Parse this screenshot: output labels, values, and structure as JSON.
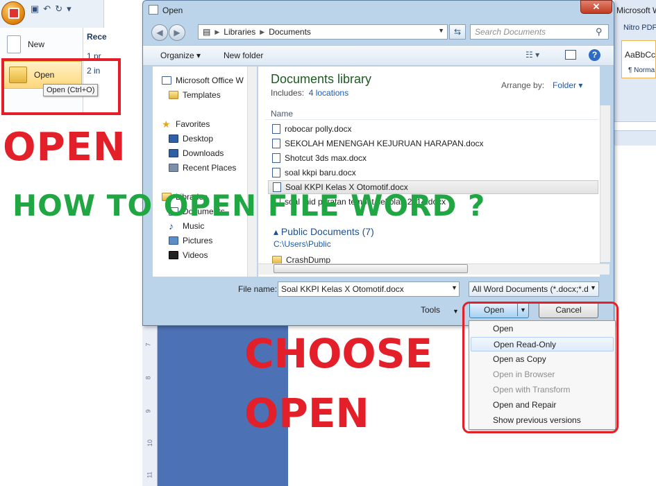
{
  "word": {
    "menu": {
      "new_label": "New",
      "open_label": "Open",
      "open_tooltip": "Open (Ctrl+O)",
      "recent_title": "Rece",
      "recent_items": [
        "1  pr",
        "2  in"
      ]
    },
    "right": {
      "title": "Microsoft W",
      "tab": "Nitro PDF",
      "style_sample": "AaBbCc",
      "style_name": "¶ Norma"
    },
    "ruler_numbers": [
      "7",
      "8",
      "9",
      "10",
      "11"
    ]
  },
  "dialog": {
    "title": "Open",
    "close_glyph": "✕",
    "breadcrumb": [
      "Libraries",
      "Documents"
    ],
    "search_placeholder": "Search Documents",
    "toolbar": {
      "organize": "Organize ▾",
      "new_folder": "New folder",
      "help": "?"
    },
    "nav": {
      "word_root": "Microsoft Office W",
      "templates": "Templates",
      "favorites": "Favorites",
      "desktop": "Desktop",
      "downloads": "Downloads",
      "recent_places": "Recent Places",
      "libraries": "Libraries",
      "documents": "Documents",
      "music": "Music",
      "pictures": "Pictures",
      "videos": "Videos"
    },
    "library": {
      "title": "Documents library",
      "includes_label": "Includes:",
      "includes_link": "4 locations",
      "arrange_label": "Arrange by:",
      "arrange_value": "Folder ▾",
      "column_name": "Name"
    },
    "files": [
      "robocar polly.docx",
      "SEKOLAH MENENGAH KEJURUAN HARAPAN.docx",
      "Shotcut 3ds max.docx",
      "soal kkpi baru.docx",
      "Soal KKPI Kelas X Otomotif.docx",
      "soal mid peratan tempat sekolah 2014.docx"
    ],
    "selected_index": 4,
    "public_group": {
      "title": "Public Documents (7)",
      "path": "C:\\Users\\Public",
      "first_item": "CrashDump"
    },
    "file_name_label": "File name:",
    "file_name_value": "Soal KKPI Kelas X Otomotif.docx",
    "file_type": "All Word Documents (*.docx;*.d",
    "tools_label": "Tools",
    "open_button": "Open",
    "cancel_button": "Cancel"
  },
  "open_menu": {
    "items": [
      {
        "label": "Open",
        "enabled": true
      },
      {
        "label": "Open Read-Only",
        "enabled": true,
        "hover": true
      },
      {
        "label": "Open as Copy",
        "enabled": true
      },
      {
        "label": "Open in Browser",
        "enabled": false
      },
      {
        "label": "Open with Transform",
        "enabled": false
      },
      {
        "label": "Open and Repair",
        "enabled": true
      },
      {
        "label": "Show previous versions",
        "enabled": true
      }
    ]
  },
  "captions": {
    "open": "OPEN",
    "howto": "HOW TO OPEN FILE WORD ?",
    "choose": "CHOOSE",
    "open2": "OPEN"
  },
  "colors": {
    "caption_red": "#e3202a",
    "caption_green": "#21a644",
    "dialog_frame": "#bcd4ea",
    "library_title": "#1d5a20"
  }
}
